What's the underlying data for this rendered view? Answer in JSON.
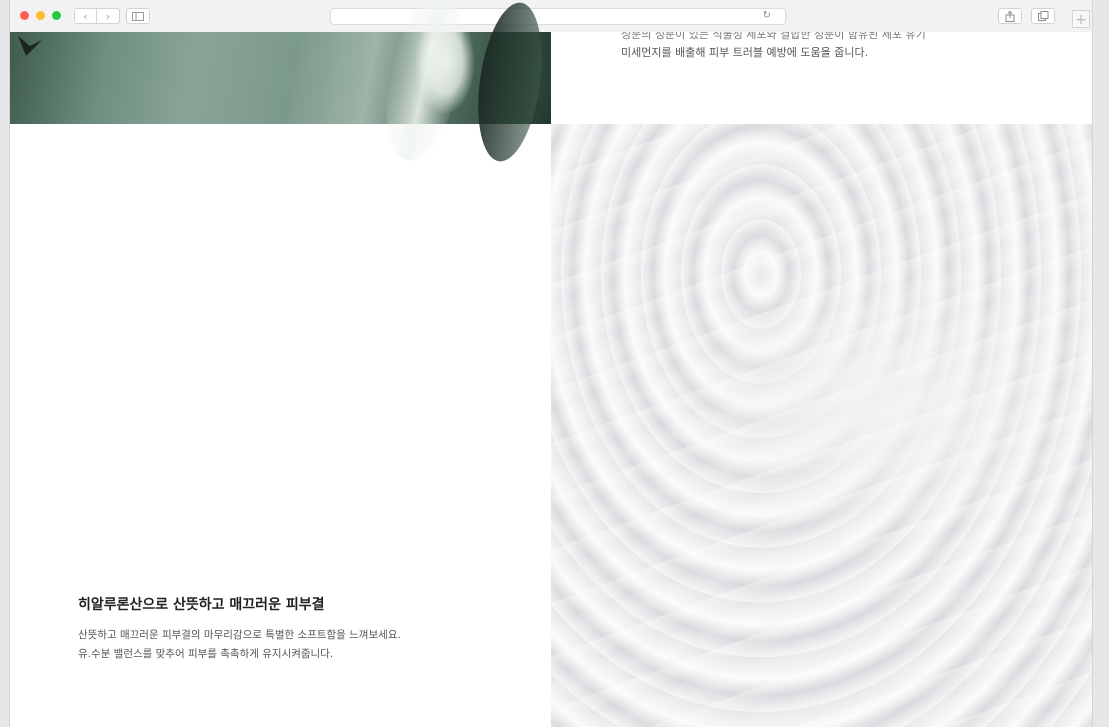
{
  "browser": {
    "back_icon": "chevron-left-icon",
    "forward_icon": "chevron-right-icon",
    "sidebar_icon": "sidebar-icon",
    "reload_glyph": "↻",
    "share_icon": "share-icon",
    "tabs_icon": "tabs-overview-icon",
    "new_tab_glyph": "+",
    "traffic_lights": {
      "close": "#ff5f57",
      "minimize": "#febc2e",
      "zoom": "#28c840"
    }
  },
  "sections": {
    "aloe_text": {
      "line1_cut": "성분의 성분이 있는 식물성 세포와 결합한 성분이 함유된 세포 유기",
      "line2": "미세먼지를 배출해 피부 트러블 예방에 도움을 줍니다."
    },
    "hyaluronic": {
      "title": "히알루론산으로 산뜻하고 매끄러운 피부결",
      "line1": "산뜻하고 매끄러운 피부결의 마무리감으로 특별한 소프트함을 느껴보세요.",
      "line2": "유.수분 밸런스를 맞추어 피부를 촉촉하게 유지시켜줍니다."
    }
  }
}
